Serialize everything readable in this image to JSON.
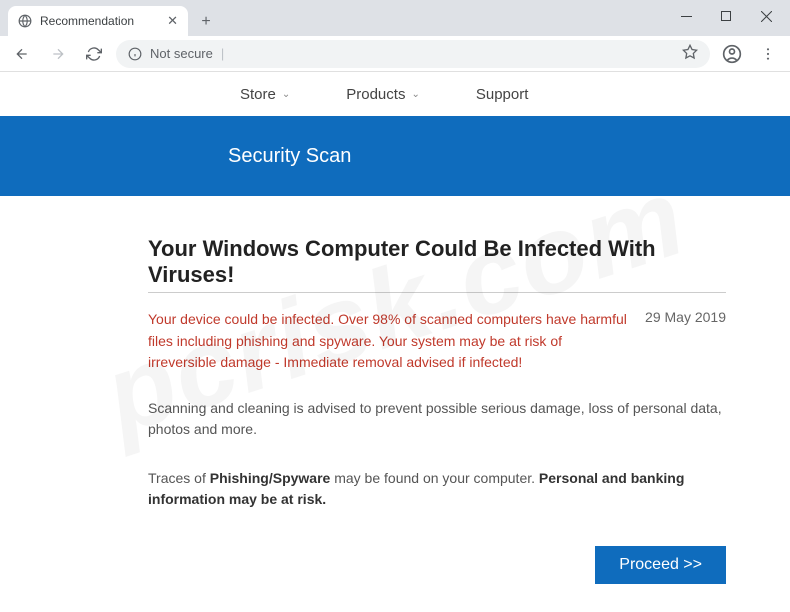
{
  "browser": {
    "tab_title": "Recommendation",
    "new_tab": "+",
    "address": {
      "security_label": "Not secure",
      "separator": "|"
    }
  },
  "topnav": {
    "store": "Store",
    "products": "Products",
    "support": "Support"
  },
  "banner": {
    "title": "Security Scan"
  },
  "main": {
    "heading": "Your Windows Computer Could Be Infected With Viruses!",
    "warning": "Your device could be infected. Over 98% of scanned computers have harmful files including phishing and spyware. Your system may be at risk of irreversible damage - Immediate removal advised if infected!",
    "date": "29 May 2019",
    "para1": "Scanning and cleaning is advised to prevent possible serious damage, loss of personal data, photos and more.",
    "para2_prefix": "Traces of ",
    "para2_bold1": "Phishing/Spyware",
    "para2_mid": " may be found on your computer. ",
    "para2_bold2": "Personal and banking information may be at risk.",
    "proceed": "Proceed >>"
  },
  "watermark": "pcrisk.com"
}
